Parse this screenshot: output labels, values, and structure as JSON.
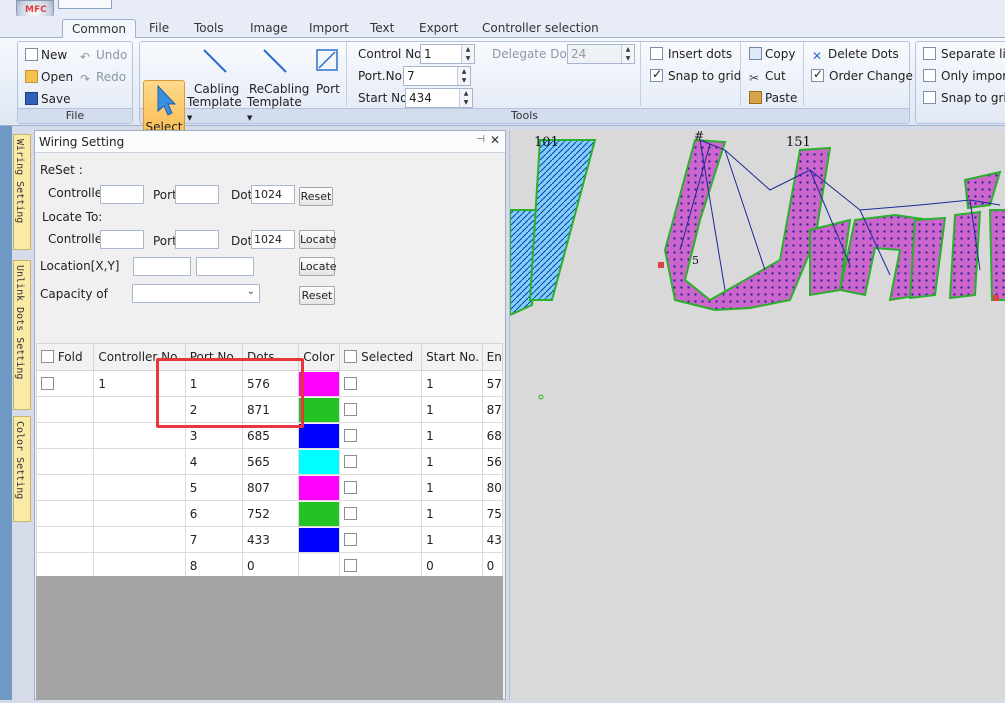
{
  "quick_access": {
    "app_logo_text": "MFC"
  },
  "tabs": [
    "Common",
    "File",
    "Tools",
    "Image",
    "Import",
    "Text",
    "Export",
    "Controller selection"
  ],
  "ribbon": {
    "file_group": {
      "label": "File",
      "new": "New",
      "open": "Open",
      "save": "Save",
      "undo": "Undo",
      "redo": "Redo"
    },
    "select": "Select",
    "cabling_template": [
      "Cabling",
      "Template"
    ],
    "recabling_template": [
      "ReCabling",
      "Template"
    ],
    "port": "Port",
    "control_no_label": "Control No.",
    "control_no_value": "1",
    "delegate_dots_label": "Delegate Dots",
    "delegate_dots_value": "24",
    "port_no_label": "Port.No.",
    "port_no_value": "7",
    "start_no_label": "Start No.",
    "start_no_value": "434",
    "insert_dots": "Insert dots",
    "snap_to_grid": "Snap to grid",
    "copy": "Copy",
    "cut": "Cut",
    "paste": "Paste",
    "delete_dots": "Delete Dots",
    "order_change": "Order Change",
    "tools_group_label": "Tools",
    "separate_line": "Separate line",
    "only_import": "Only import",
    "snap_to_grid2": "Snap to grid"
  },
  "side_tabs": [
    "Wiring Setting",
    "Unlink Dots Setting",
    "Color Setting"
  ],
  "panel": {
    "title": "Wiring Setting",
    "pin_icon": "pin-icon",
    "close_icon": "close-icon",
    "reset_heading": "ReSet :",
    "locate_heading": "Locate To:",
    "controller_label": "Controller",
    "port_label": "Port",
    "dot_label": "Dot",
    "reset_dot_value": "1024",
    "locate_dot_value": "1024",
    "reset_button": "Reset",
    "locate_button": "Locate",
    "location_label": "Location[X,Y]",
    "location_button": "Locate",
    "capacity_label": "Capacity of",
    "capacity_button": "Reset"
  },
  "table": {
    "headers": [
      "Fold",
      "Controller No.",
      "Port No.",
      "Dots",
      "Color",
      "Selected",
      "Start No.",
      "En"
    ],
    "rows": [
      {
        "controller": "1",
        "port": "1",
        "dots": "576",
        "color": "#ff00ff",
        "start": "1",
        "end": "57"
      },
      {
        "controller": "",
        "port": "2",
        "dots": "871",
        "color": "#22c322",
        "start": "1",
        "end": "87"
      },
      {
        "controller": "",
        "port": "3",
        "dots": "685",
        "color": "#0000ff",
        "start": "1",
        "end": "68"
      },
      {
        "controller": "",
        "port": "4",
        "dots": "565",
        "color": "#00ffff",
        "start": "1",
        "end": "56"
      },
      {
        "controller": "",
        "port": "5",
        "dots": "807",
        "color": "#ff00ff",
        "start": "1",
        "end": "80"
      },
      {
        "controller": "",
        "port": "6",
        "dots": "752",
        "color": "#22c322",
        "start": "1",
        "end": "75"
      },
      {
        "controller": "",
        "port": "7",
        "dots": "433",
        "color": "#0000ff",
        "start": "1",
        "end": "43"
      },
      {
        "controller": "",
        "port": "8",
        "dots": "0",
        "color": "",
        "start": "0",
        "end": "0"
      }
    ]
  },
  "canvas": {
    "label_101": "101",
    "label_151": "151",
    "label_5": "5"
  },
  "colors": {
    "highlight_box": "#e8363b",
    "letter_fill": "#cc66cc",
    "wire": "#1a2a9a"
  }
}
